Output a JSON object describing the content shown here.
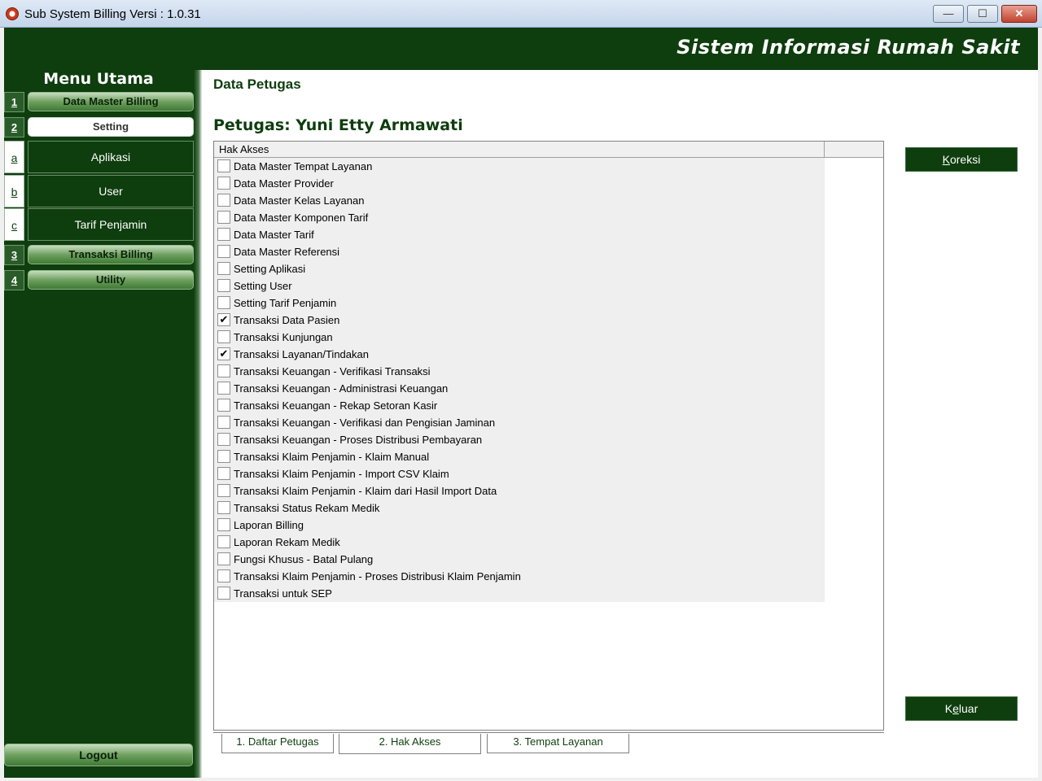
{
  "window": {
    "title": "Sub System Billing Versi : 1.0.31",
    "min": "—",
    "max": "☐",
    "close": "✕"
  },
  "header": {
    "title": "Sistem Informasi Rumah Sakit"
  },
  "sidebar": {
    "title": "Menu Utama",
    "items": [
      {
        "num": "1",
        "label": "Data Master Billing"
      },
      {
        "num": "2",
        "label": "Setting"
      },
      {
        "num": "a",
        "label": "Aplikasi"
      },
      {
        "num": "b",
        "label": "User"
      },
      {
        "num": "c",
        "label": "Tarif Penjamin"
      },
      {
        "num": "3",
        "label": "Transaksi Billing"
      },
      {
        "num": "4",
        "label": "Utility"
      }
    ],
    "logout": "Logout"
  },
  "main": {
    "page_title": "Data Petugas",
    "petugas_label": "Petugas: Yuni Etty Armawati",
    "grid_header": "Hak Akses",
    "rows": [
      {
        "label": "Data Master Tempat Layanan",
        "checked": false
      },
      {
        "label": "Data Master Provider",
        "checked": false
      },
      {
        "label": "Data Master Kelas Layanan",
        "checked": false
      },
      {
        "label": "Data Master Komponen Tarif",
        "checked": false
      },
      {
        "label": "Data Master Tarif",
        "checked": false
      },
      {
        "label": "Data Master Referensi",
        "checked": false
      },
      {
        "label": "Setting Aplikasi",
        "checked": false
      },
      {
        "label": "Setting User",
        "checked": false
      },
      {
        "label": "Setting Tarif Penjamin",
        "checked": false
      },
      {
        "label": "Transaksi Data Pasien",
        "checked": true
      },
      {
        "label": "Transaksi Kunjungan",
        "checked": false
      },
      {
        "label": "Transaksi Layanan/Tindakan",
        "checked": true
      },
      {
        "label": "Transaksi Keuangan - Verifikasi Transaksi",
        "checked": false
      },
      {
        "label": "Transaksi Keuangan - Administrasi Keuangan",
        "checked": false
      },
      {
        "label": "Transaksi Keuangan - Rekap Setoran Kasir",
        "checked": false
      },
      {
        "label": "Transaksi Keuangan - Verifikasi dan Pengisian Jaminan",
        "checked": false
      },
      {
        "label": "Transaksi Keuangan - Proses Distribusi Pembayaran",
        "checked": false
      },
      {
        "label": "Transaksi Klaim Penjamin - Klaim Manual",
        "checked": false
      },
      {
        "label": "Transaksi Klaim Penjamin - Import CSV Klaim",
        "checked": false
      },
      {
        "label": "Transaksi Klaim Penjamin - Klaim dari Hasil Import Data",
        "checked": false
      },
      {
        "label": "Transaksi Status Rekam Medik",
        "checked": false
      },
      {
        "label": "Laporan Billing",
        "checked": false
      },
      {
        "label": "Laporan Rekam Medik",
        "checked": false
      },
      {
        "label": "Fungsi Khusus - Batal Pulang",
        "checked": false
      },
      {
        "label": "Transaksi Klaim Penjamin - Proses Distribusi Klaim Penjamin",
        "checked": false
      },
      {
        "label": "Transaksi untuk SEP",
        "checked": false
      }
    ],
    "buttons": {
      "koreksi_first": "K",
      "koreksi_rest": "oreksi",
      "keluar_first": "K",
      "keluar_u": "e",
      "keluar_rest": "luar"
    },
    "tabs": [
      "1. Daftar Petugas",
      "2. Hak Akses",
      "3. Tempat Layanan"
    ]
  },
  "colors": {
    "primary": "#0e3d0e",
    "accent": "#3f7a35"
  }
}
